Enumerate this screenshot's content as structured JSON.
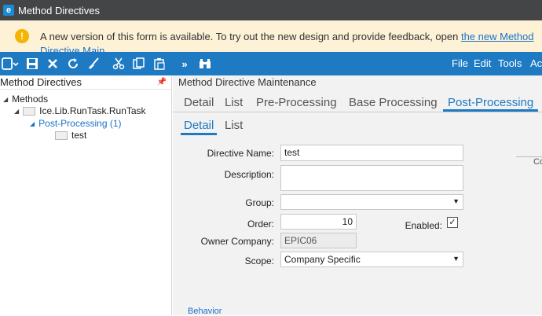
{
  "window": {
    "title": "Method Directives",
    "logo": "e"
  },
  "notice": {
    "icon": "warning-icon",
    "text": "A new version of this form is available. To try out the new design and provide feedback, open ",
    "link": "the new Method",
    "link_continued": "Directive Main"
  },
  "toolbar": {
    "icons": [
      "new-icon",
      "save-icon",
      "delete-icon",
      "refresh-icon",
      "clear-icon",
      "cut-icon",
      "copy-icon",
      "paste-icon",
      "overflow-icon",
      "search-icon"
    ],
    "menu": [
      "File",
      "Edit",
      "Tools",
      "Ac"
    ]
  },
  "left_pane": {
    "title": "Method Directives",
    "tree": {
      "root": "Methods",
      "method": "Ice.Lib.RunTask.RunTask",
      "group": "Post-Processing (1)",
      "leaf": "test"
    }
  },
  "main": {
    "header": "Method Directive Maintenance",
    "tabs": [
      "Detail",
      "List",
      "Pre-Processing",
      "Base Processing",
      "Post-Processing"
    ],
    "active_tab": "Post-Processing",
    "subtabs": [
      "Detail",
      "List"
    ],
    "active_subtab": "Detail",
    "form": {
      "directive_name_label": "Directive Name:",
      "directive_name": "test",
      "description_label": "Description:",
      "description": "",
      "group_label": "Group:",
      "group": "",
      "order_label": "Order:",
      "order": "10",
      "enabled_label": "Enabled:",
      "enabled": true,
      "owner_company_label": "Owner Company:",
      "owner_company": "EPIC06",
      "scope_label": "Scope:",
      "scope": "Company Specific",
      "side_button": "Co",
      "behavior_label": "Behavior"
    }
  },
  "colors": {
    "accent": "#1e7ac2",
    "titlebar": "#444547",
    "notice_bg": "#fdf1d6",
    "warning": "#f5b400"
  }
}
